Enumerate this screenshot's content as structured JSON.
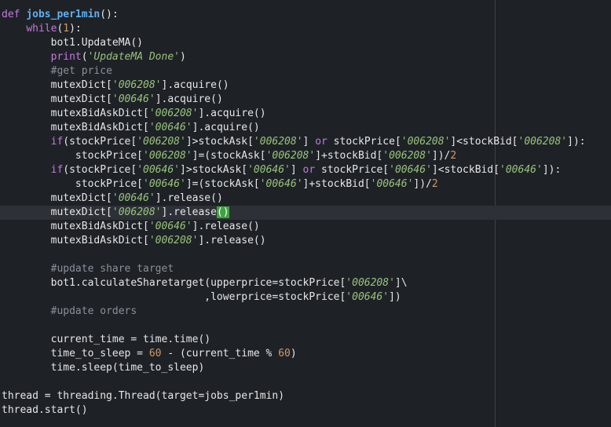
{
  "editor": {
    "lines": [
      [
        [
          "def",
          "def"
        ],
        [
          "plain",
          " "
        ],
        [
          "fn-def",
          "jobs_per1min"
        ],
        [
          "plain",
          "():"
        ]
      ],
      [
        [
          "plain",
          "    "
        ],
        [
          "kw",
          "while"
        ],
        [
          "plain",
          "("
        ],
        [
          "num",
          "1"
        ],
        [
          "plain",
          "):"
        ]
      ],
      [
        [
          "plain",
          "        bot1.UpdateMA()"
        ]
      ],
      [
        [
          "plain",
          "        "
        ],
        [
          "builtin",
          "print"
        ],
        [
          "plain",
          "("
        ],
        [
          "str",
          "'UpdateMA Done'"
        ],
        [
          "plain",
          ")"
        ]
      ],
      [
        [
          "plain",
          "        "
        ],
        [
          "cmt",
          "#get price"
        ]
      ],
      [
        [
          "plain",
          "        mutexDict["
        ],
        [
          "str",
          "'006208'"
        ],
        [
          "plain",
          "].acquire()"
        ]
      ],
      [
        [
          "plain",
          "        mutexDict["
        ],
        [
          "str",
          "'00646'"
        ],
        [
          "plain",
          "].acquire()"
        ]
      ],
      [
        [
          "plain",
          "        mutexBidAskDict["
        ],
        [
          "str",
          "'006208'"
        ],
        [
          "plain",
          "].acquire()"
        ]
      ],
      [
        [
          "plain",
          "        mutexBidAskDict["
        ],
        [
          "str",
          "'00646'"
        ],
        [
          "plain",
          "].acquire()"
        ]
      ],
      [
        [
          "plain",
          "        "
        ],
        [
          "kw",
          "if"
        ],
        [
          "plain",
          "(stockPrice["
        ],
        [
          "str",
          "'006208'"
        ],
        [
          "plain",
          "]>stockAsk["
        ],
        [
          "str",
          "'006208'"
        ],
        [
          "plain",
          "] "
        ],
        [
          "op",
          "or"
        ],
        [
          "plain",
          " stockPrice["
        ],
        [
          "str",
          "'006208'"
        ],
        [
          "plain",
          "]<stockBid["
        ],
        [
          "str",
          "'006208'"
        ],
        [
          "plain",
          "]):"
        ]
      ],
      [
        [
          "plain",
          "            stockPrice["
        ],
        [
          "str",
          "'006208'"
        ],
        [
          "plain",
          "]=(stockAsk["
        ],
        [
          "str",
          "'006208'"
        ],
        [
          "plain",
          "]+stockBid["
        ],
        [
          "str",
          "'006208'"
        ],
        [
          "plain",
          "])/"
        ],
        [
          "num",
          "2"
        ]
      ],
      [
        [
          "plain",
          "        "
        ],
        [
          "kw",
          "if"
        ],
        [
          "plain",
          "(stockPrice["
        ],
        [
          "str",
          "'00646'"
        ],
        [
          "plain",
          "]>stockAsk["
        ],
        [
          "str",
          "'00646'"
        ],
        [
          "plain",
          "] "
        ],
        [
          "op",
          "or"
        ],
        [
          "plain",
          " stockPrice["
        ],
        [
          "str",
          "'00646'"
        ],
        [
          "plain",
          "]<stockBid["
        ],
        [
          "str",
          "'00646'"
        ],
        [
          "plain",
          "]):"
        ]
      ],
      [
        [
          "plain",
          "            stockPrice["
        ],
        [
          "str",
          "'00646'"
        ],
        [
          "plain",
          "]=(stockAsk["
        ],
        [
          "str",
          "'00646'"
        ],
        [
          "plain",
          "]+stockBid["
        ],
        [
          "str",
          "'00646'"
        ],
        [
          "plain",
          "])/"
        ],
        [
          "num",
          "2"
        ]
      ],
      [
        [
          "plain",
          "        mutexDict["
        ],
        [
          "str",
          "'00646'"
        ],
        [
          "plain",
          "].release()"
        ]
      ],
      [
        [
          "plain",
          "        mutexDict["
        ],
        [
          "str",
          "'006208'"
        ],
        [
          "plain",
          "].release"
        ],
        [
          "bracket-match",
          "()"
        ]
      ],
      [
        [
          "plain",
          "        mutexBidAskDict["
        ],
        [
          "str",
          "'00646'"
        ],
        [
          "plain",
          "].release()"
        ]
      ],
      [
        [
          "plain",
          "        mutexBidAskDict["
        ],
        [
          "str",
          "'006208'"
        ],
        [
          "plain",
          "].release()"
        ]
      ],
      [
        [
          "plain",
          ""
        ]
      ],
      [
        [
          "plain",
          "        "
        ],
        [
          "cmt",
          "#update share target"
        ]
      ],
      [
        [
          "plain",
          "        bot1.calculateSharetarget(upperprice=stockPrice["
        ],
        [
          "str",
          "'006208'"
        ],
        [
          "plain",
          "]\\"
        ]
      ],
      [
        [
          "plain",
          "                                 ,lowerprice=stockPrice["
        ],
        [
          "str",
          "'00646'"
        ],
        [
          "plain",
          "])"
        ]
      ],
      [
        [
          "plain",
          "        "
        ],
        [
          "cmt",
          "#update orders"
        ]
      ],
      [
        [
          "plain",
          ""
        ]
      ],
      [
        [
          "plain",
          "        current_time = time.time()"
        ]
      ],
      [
        [
          "plain",
          "        time_to_sleep = "
        ],
        [
          "num",
          "60"
        ],
        [
          "plain",
          " - (current_time % "
        ],
        [
          "num",
          "60"
        ],
        [
          "plain",
          ")"
        ]
      ],
      [
        [
          "plain",
          "        time.sleep(time_to_sleep)"
        ]
      ],
      [
        [
          "plain",
          ""
        ]
      ],
      [
        [
          "plain",
          "thread = threading.Thread(target=jobs_per1min)"
        ]
      ],
      [
        [
          "plain",
          "thread.start()"
        ]
      ]
    ],
    "current_line": 14
  }
}
